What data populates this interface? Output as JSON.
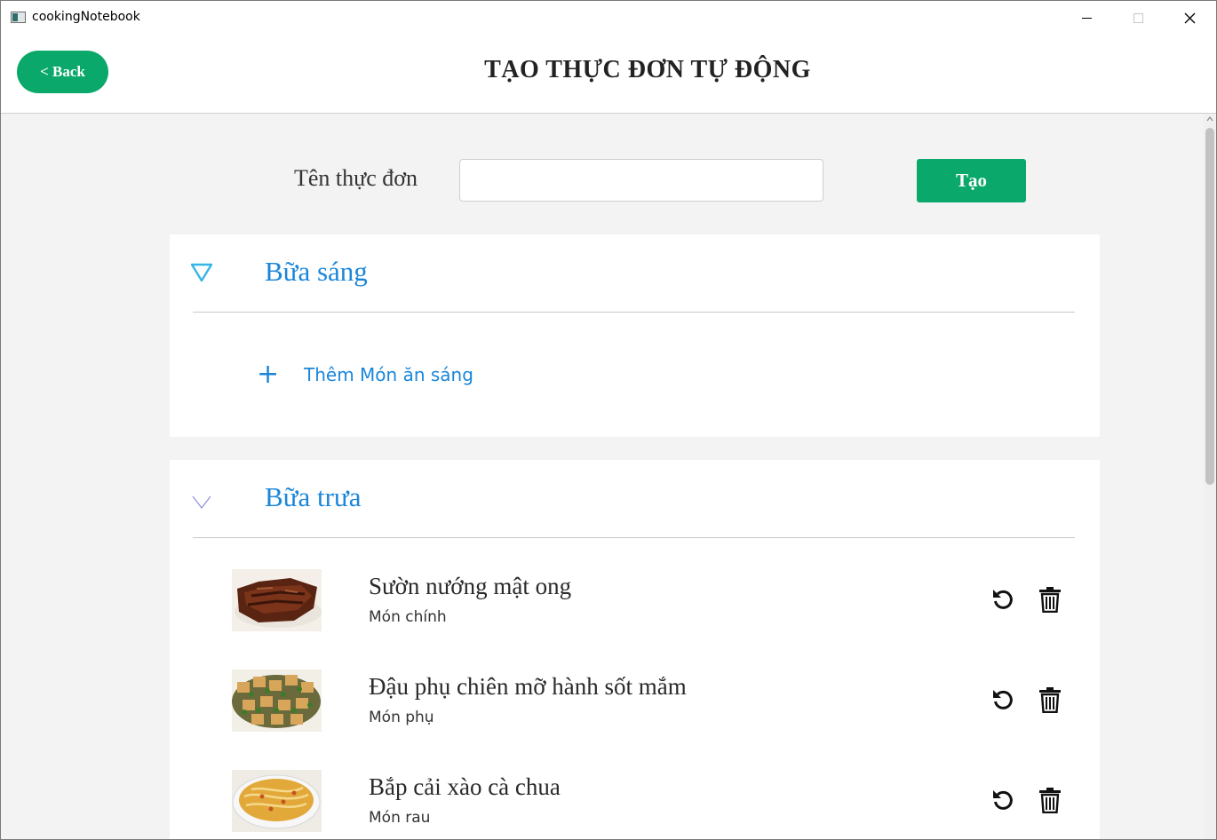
{
  "window": {
    "title": "cookingNotebook"
  },
  "header": {
    "back_label": "< Back",
    "title": "TẠO THỰC ĐƠN TỰ ĐỘNG"
  },
  "form": {
    "name_label": "Tên thực đơn",
    "name_value": "",
    "name_placeholder": "",
    "create_label": "Tạo"
  },
  "meals": [
    {
      "title": "Bữa sáng",
      "add_label": "Thêm Món ăn sáng"
    },
    {
      "title": "Bữa trưa"
    }
  ],
  "lunch_dishes": [
    {
      "name": "Sườn nướng mật ong",
      "type": "Món chính"
    },
    {
      "name": "Đậu phụ chiên mỡ hành sốt mắm",
      "type": "Món phụ"
    },
    {
      "name": "Bắp cải xào cà chua",
      "type": "Món rau"
    }
  ],
  "colors": {
    "accent_green": "#0aa86a",
    "link_blue": "#1a86d9",
    "background": "#f3f3f3"
  },
  "icons": [
    "minimize-icon",
    "maximize-icon",
    "close-icon",
    "triangle-down-icon",
    "chevron-down-icon",
    "plus-icon",
    "refresh-icon",
    "trash-icon"
  ]
}
